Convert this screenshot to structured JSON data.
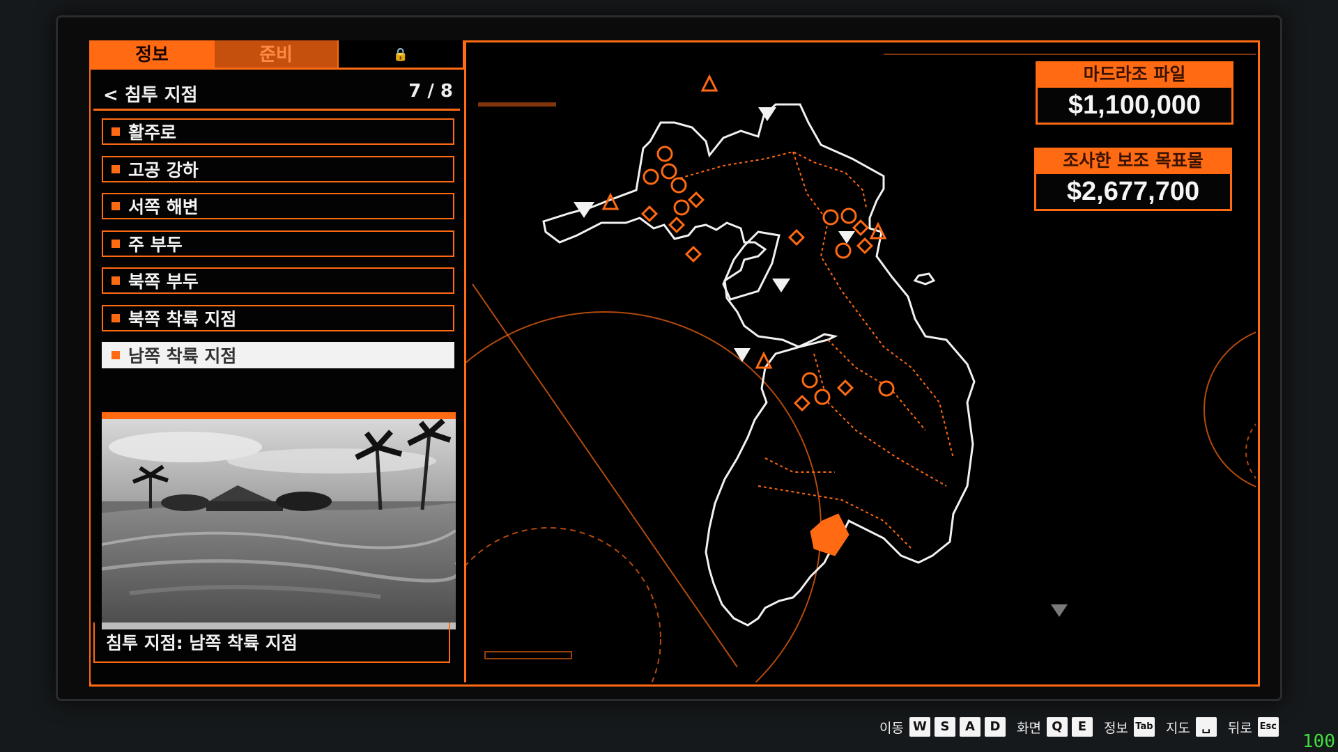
{
  "tabs": {
    "info": "정보",
    "prep": "준비",
    "locked": "🔒"
  },
  "header": {
    "title": "< 침투 지점",
    "count": "7 / 8"
  },
  "entry_points": [
    {
      "label": "활주로"
    },
    {
      "label": "고공 강하"
    },
    {
      "label": "서쪽 해변"
    },
    {
      "label": "주 부두"
    },
    {
      "label": "북쪽 부두"
    },
    {
      "label": "북쪽 착륙 지점"
    },
    {
      "label": "남쪽 착륙 지점"
    }
  ],
  "selected_index": 6,
  "caption": "침투 지점: 남쪽 착륙 지점",
  "primary_target": {
    "label": "마드라조 파일",
    "value": "$1,100,000"
  },
  "secondary_targets": {
    "label": "조사한 보조 목표물",
    "value": "$2,677,700"
  },
  "controls": [
    {
      "label": "이동",
      "keys": [
        "W",
        "S",
        "A",
        "D"
      ]
    },
    {
      "label": "화면",
      "keys": [
        "Q",
        "E"
      ]
    },
    {
      "label": "정보",
      "keys": [
        "Tab"
      ]
    },
    {
      "label": "지도",
      "keys": [
        "␣"
      ]
    },
    {
      "label": "뒤로",
      "keys": [
        "Esc"
      ]
    }
  ],
  "fps": "100",
  "colors": {
    "accent": "#ff6a13",
    "background": "#000000",
    "text": "#f2f2f2"
  },
  "map_icons": [
    "cash-icon",
    "weed-icon",
    "cocaine-icon",
    "diamond-marker-icon",
    "entry-triangle-icon",
    "guard-triangle-icon"
  ]
}
